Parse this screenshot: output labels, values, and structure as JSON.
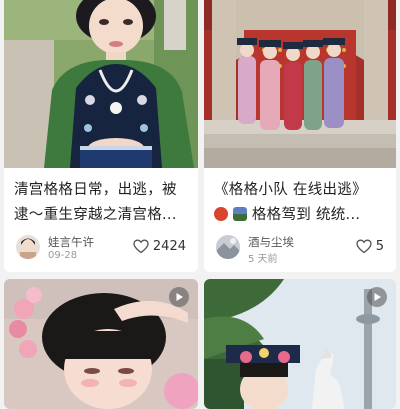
{
  "feed": {
    "cards": [
      {
        "title_lines": [
          "清宫格格日常，出逃，被",
          "逮～重生穿越之清宫格..."
        ],
        "author": "娃言午许",
        "date": "09-28",
        "likes": "2424"
      },
      {
        "title_line_1": "《格格小队 在线出逃》",
        "title_line_2": "格格驾到 统统...",
        "author": "酒与尘埃",
        "date": "5 天前",
        "likes": "5"
      },
      {
        "has_video": true
      },
      {
        "has_video": true
      }
    ]
  },
  "colors": {
    "background": "#f2f2f2",
    "card": "#ffffff",
    "title_text": "#222222",
    "meta_text": "#999999",
    "palace_red": "#b5342a"
  },
  "icons": [
    "heart-outline-icon",
    "play-icon",
    "lantern-emoji-icon",
    "picture-emoji-icon"
  ]
}
